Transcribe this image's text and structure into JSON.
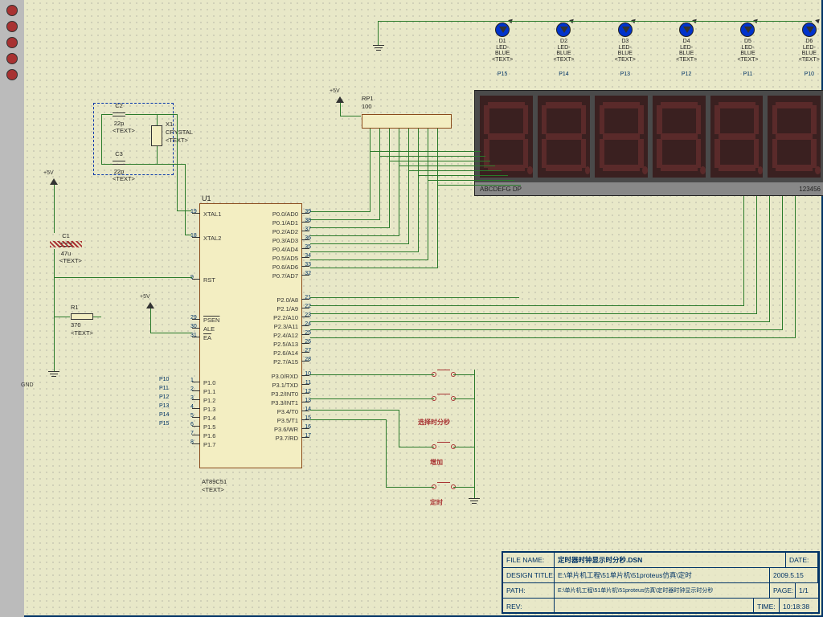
{
  "mcu": {
    "ref": "U1",
    "part": "AT89C51",
    "text_note": "<TEXT>",
    "left_pins": [
      {
        "num": "19",
        "name": "XTAL1"
      },
      {
        "num": "18",
        "name": "XTAL2"
      },
      {
        "num": "9",
        "name": "RST"
      },
      {
        "num": "29",
        "name": "PSEN"
      },
      {
        "num": "30",
        "name": "ALE"
      },
      {
        "num": "31",
        "name": "EA"
      },
      {
        "num": "1",
        "name": "P1.0",
        "ext": "P10"
      },
      {
        "num": "2",
        "name": "P1.1",
        "ext": "P11"
      },
      {
        "num": "3",
        "name": "P1.2",
        "ext": "P12"
      },
      {
        "num": "4",
        "name": "P1.3",
        "ext": "P13"
      },
      {
        "num": "5",
        "name": "P1.4",
        "ext": "P14"
      },
      {
        "num": "6",
        "name": "P1.5",
        "ext": "P15"
      },
      {
        "num": "7",
        "name": "P1.6"
      },
      {
        "num": "8",
        "name": "P1.7"
      }
    ],
    "right_pins": [
      {
        "num": "39",
        "name": "P0.0/AD0"
      },
      {
        "num": "38",
        "name": "P0.1/AD1"
      },
      {
        "num": "37",
        "name": "P0.2/AD2"
      },
      {
        "num": "36",
        "name": "P0.3/AD3"
      },
      {
        "num": "35",
        "name": "P0.4/AD4"
      },
      {
        "num": "34",
        "name": "P0.5/AD5"
      },
      {
        "num": "33",
        "name": "P0.6/AD6"
      },
      {
        "num": "32",
        "name": "P0.7/AD7"
      },
      {
        "num": "21",
        "name": "P2.0/A8"
      },
      {
        "num": "22",
        "name": "P2.1/A9"
      },
      {
        "num": "23",
        "name": "P2.2/A10"
      },
      {
        "num": "24",
        "name": "P2.3/A11"
      },
      {
        "num": "25",
        "name": "P2.4/A12"
      },
      {
        "num": "26",
        "name": "P2.5/A13"
      },
      {
        "num": "27",
        "name": "P2.6/A14"
      },
      {
        "num": "28",
        "name": "P2.7/A15"
      },
      {
        "num": "10",
        "name": "P3.0/RXD"
      },
      {
        "num": "11",
        "name": "P3.1/TXD"
      },
      {
        "num": "12",
        "name": "P3.2/INT0"
      },
      {
        "num": "13",
        "name": "P3.3/INT1"
      },
      {
        "num": "14",
        "name": "P3.4/T0"
      },
      {
        "num": "15",
        "name": "P3.5/T1"
      },
      {
        "num": "16",
        "name": "P3.6/WR"
      },
      {
        "num": "17",
        "name": "P3.7/RD"
      }
    ]
  },
  "caps": [
    {
      "ref": "C2",
      "val": "22p",
      "note": "<TEXT>"
    },
    {
      "ref": "C3",
      "val": "22p",
      "note": "<TEXT>"
    },
    {
      "ref": "C1",
      "val": "47u",
      "note": "<TEXT>"
    }
  ],
  "crystal": {
    "ref": "X1",
    "val": "CRYSTAL",
    "note": "<TEXT>"
  },
  "res": {
    "ref": "R1",
    "val": "370",
    "note": "<TEXT>"
  },
  "resnet": {
    "ref": "RP1",
    "val": "100",
    "note": "<TEXT>"
  },
  "leds": [
    {
      "ref": "D1",
      "type": "LED-BLUE",
      "pin": "P15"
    },
    {
      "ref": "D2",
      "type": "LED-BLUE",
      "pin": "P14"
    },
    {
      "ref": "D3",
      "type": "LED-BLUE",
      "pin": "P13"
    },
    {
      "ref": "D4",
      "type": "LED-BLUE",
      "pin": "P12"
    },
    {
      "ref": "D5",
      "type": "LED-BLUE",
      "pin": "P11"
    },
    {
      "ref": "D6",
      "type": "LED-BLUE",
      "pin": "P10"
    }
  ],
  "display": {
    "left_label": "ABCDEFG DP",
    "right_label": "123456"
  },
  "buttons": {
    "select": "选择时分秒",
    "inc": "增加",
    "set": "定时"
  },
  "power": {
    "vcc": "+5V",
    "gnd": "GND"
  },
  "titleblock": {
    "file_lbl": "FILE NAME:",
    "file": "定时器时钟显示时分秒.DSN",
    "design_lbl": "DESIGN TITLE:",
    "design": "E:\\单片机工程\\51单片机\\51proteus仿真\\定时",
    "path_lbl": "PATH:",
    "path": "E:\\单片机工程\\51单片机\\51proteus仿真\\定时器时钟显示时分秒",
    "date_lbl": "DATE:",
    "date": "2009.5.15",
    "page_lbl": "PAGE:",
    "page": "1/1",
    "rev_lbl": "REV:",
    "rev": "",
    "time_lbl": "TIME:",
    "time": "10:18:38"
  }
}
